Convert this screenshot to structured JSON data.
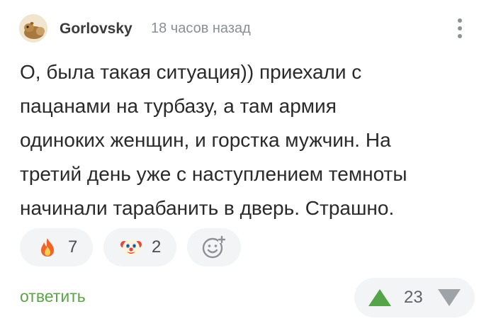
{
  "comment": {
    "author": "Gorlovsky",
    "time": "18 часов назад",
    "text": "О, была такая ситуация)) приехали с\nпацанами на турбазу, а там армия\nодиноких женщин, и горстка мужчин. На\nтретий день уже с наступлением темноты\nначинали тарабанить в дверь. Страшно."
  },
  "reactions": [
    {
      "icon": "fire-icon",
      "count": "7"
    },
    {
      "icon": "clown-icon",
      "count": "2"
    },
    {
      "icon": "add-reaction-icon"
    }
  ],
  "actions": {
    "reply_label": "ответить"
  },
  "rating": {
    "score": "23"
  },
  "colors": {
    "reply": "#5ba548",
    "upvote": "#55a44a",
    "downvote": "#9ea3a8",
    "pill_bg": "#f3f4f5"
  }
}
